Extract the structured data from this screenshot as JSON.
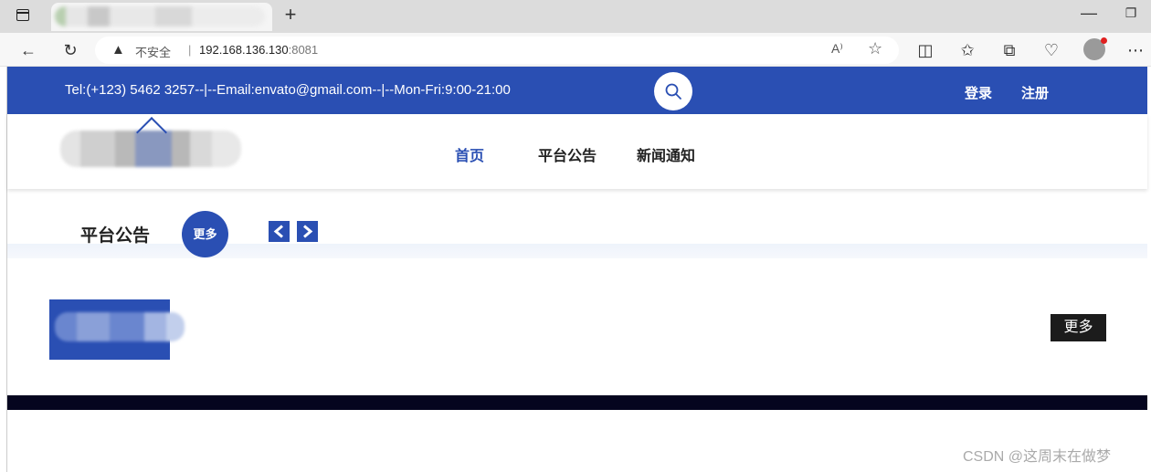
{
  "browser": {
    "new_tab_symbol": "+",
    "minimize_symbol": "—",
    "restore_symbol": "❐",
    "address": {
      "warning_symbol": "▲",
      "security_label": "不安全",
      "separator": "|",
      "host": "192.168.136.130",
      "port": ":8081",
      "read_aloud": "A⁾",
      "favorite_symbol": "☆"
    },
    "icons": {
      "back": "←",
      "refresh": "↻",
      "split": "◫",
      "favorites": "✩",
      "collections": "⧉",
      "performance": "♡",
      "more": "⋯"
    }
  },
  "topbar": {
    "contact": "Tel:(+123) 5462 3257--|--Email:envato@gmail.com--|--Mon-Fri:9:00-21:00",
    "login": "登录",
    "register": "注册",
    "accent": "#2a4fb3"
  },
  "nav": {
    "items": [
      {
        "label": "首页",
        "active": true
      },
      {
        "label": "平台公告",
        "active": false
      },
      {
        "label": "新闻通知",
        "active": false
      }
    ]
  },
  "notice": {
    "title": "平台公告",
    "more_circle": "更多",
    "more_button": "更多"
  },
  "watermark": "CSDN @这周末在做梦"
}
